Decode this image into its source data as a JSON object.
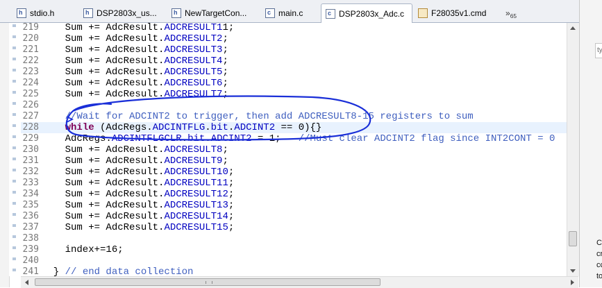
{
  "tabs": [
    {
      "label": "stdio.h",
      "icon": "h-file-icon",
      "active": false
    },
    {
      "label": "DSP2803x_us...",
      "icon": "h-file-icon",
      "active": false
    },
    {
      "label": "NewTargetCon...",
      "icon": "h-file-icon",
      "active": false
    },
    {
      "label": "main.c",
      "icon": "c-file-icon",
      "active": false
    },
    {
      "label": "DSP2803x_Adc.c",
      "icon": "c-file-icon",
      "active": true
    },
    {
      "label": "F28035v1.cmd",
      "icon": "cmd-file-icon",
      "active": false
    }
  ],
  "tab_overflow": {
    "chevron": "»",
    "count": "65"
  },
  "editor": {
    "current_line": "228",
    "lines": [
      {
        "num": "219",
        "parts": [
          {
            "t": "    Sum += AdcResult.",
            "c": ""
          },
          {
            "t": "ADCRESULT1",
            "c": "fld"
          },
          {
            "t": "1;",
            "c": ""
          }
        ]
      },
      {
        "num": "220",
        "parts": [
          {
            "t": "    Sum += AdcResult.",
            "c": ""
          },
          {
            "t": "ADCRESULT2",
            "c": "fld"
          },
          {
            "t": ";",
            "c": ""
          }
        ]
      },
      {
        "num": "221",
        "parts": [
          {
            "t": "    Sum += AdcResult.",
            "c": ""
          },
          {
            "t": "ADCRESULT3",
            "c": "fld"
          },
          {
            "t": ";",
            "c": ""
          }
        ]
      },
      {
        "num": "222",
        "parts": [
          {
            "t": "    Sum += AdcResult.",
            "c": ""
          },
          {
            "t": "ADCRESULT4",
            "c": "fld"
          },
          {
            "t": ";",
            "c": ""
          }
        ]
      },
      {
        "num": "223",
        "parts": [
          {
            "t": "    Sum += AdcResult.",
            "c": ""
          },
          {
            "t": "ADCRESULT5",
            "c": "fld"
          },
          {
            "t": ";",
            "c": ""
          }
        ]
      },
      {
        "num": "224",
        "parts": [
          {
            "t": "    Sum += AdcResult.",
            "c": ""
          },
          {
            "t": "ADCRESULT6",
            "c": "fld"
          },
          {
            "t": ";",
            "c": ""
          }
        ]
      },
      {
        "num": "225",
        "parts": [
          {
            "t": "    Sum += AdcResult.",
            "c": ""
          },
          {
            "t": "ADCRESULT7",
            "c": "fld"
          },
          {
            "t": ";",
            "c": ""
          }
        ]
      },
      {
        "num": "226",
        "parts": []
      },
      {
        "num": "227",
        "parts": [
          {
            "t": "    //Wait for ADCINT2 to trigger, then add ADCRESULT8-15 registers to sum",
            "c": "cm"
          }
        ]
      },
      {
        "num": "228",
        "parts": [
          {
            "t": "    ",
            "c": ""
          },
          {
            "t": "while",
            "c": "kw"
          },
          {
            "t": " (AdcRegs.",
            "c": ""
          },
          {
            "t": "ADCINTFLG",
            "c": "fld"
          },
          {
            "t": ".",
            "c": ""
          },
          {
            "t": "bit",
            "c": "fld"
          },
          {
            "t": ".",
            "c": ""
          },
          {
            "t": "ADCINT2",
            "c": "fld"
          },
          {
            "t": " == 0){}",
            "c": ""
          }
        ]
      },
      {
        "num": "229",
        "parts": [
          {
            "t": "    AdcRegs.",
            "c": ""
          },
          {
            "t": "ADCINTFLGCLR",
            "c": "fld"
          },
          {
            "t": ".",
            "c": ""
          },
          {
            "t": "bit",
            "c": "fld"
          },
          {
            "t": ".",
            "c": ""
          },
          {
            "t": "ADCINT2",
            "c": "fld"
          },
          {
            "t": " = 1;   ",
            "c": ""
          },
          {
            "t": "//Must clear ADCINT2 flag since INT2CONT = 0",
            "c": "cm"
          }
        ]
      },
      {
        "num": "230",
        "parts": [
          {
            "t": "    Sum += AdcResult.",
            "c": ""
          },
          {
            "t": "ADCRESULT8",
            "c": "fld"
          },
          {
            "t": ";",
            "c": ""
          }
        ]
      },
      {
        "num": "231",
        "parts": [
          {
            "t": "    Sum += AdcResult.",
            "c": ""
          },
          {
            "t": "ADCRESULT9",
            "c": "fld"
          },
          {
            "t": ";",
            "c": ""
          }
        ]
      },
      {
        "num": "232",
        "parts": [
          {
            "t": "    Sum += AdcResult.",
            "c": ""
          },
          {
            "t": "ADCRESULT10",
            "c": "fld"
          },
          {
            "t": ";",
            "c": ""
          }
        ]
      },
      {
        "num": "233",
        "parts": [
          {
            "t": "    Sum += AdcResult.",
            "c": ""
          },
          {
            "t": "ADCRESULT11",
            "c": "fld"
          },
          {
            "t": ";",
            "c": ""
          }
        ]
      },
      {
        "num": "234",
        "parts": [
          {
            "t": "    Sum += AdcResult.",
            "c": ""
          },
          {
            "t": "ADCRESULT12",
            "c": "fld"
          },
          {
            "t": ";",
            "c": ""
          }
        ]
      },
      {
        "num": "235",
        "parts": [
          {
            "t": "    Sum += AdcResult.",
            "c": ""
          },
          {
            "t": "ADCRESULT13",
            "c": "fld"
          },
          {
            "t": ";",
            "c": ""
          }
        ]
      },
      {
        "num": "236",
        "parts": [
          {
            "t": "    Sum += AdcResult.",
            "c": ""
          },
          {
            "t": "ADCRESULT14",
            "c": "fld"
          },
          {
            "t": ";",
            "c": ""
          }
        ]
      },
      {
        "num": "237",
        "parts": [
          {
            "t": "    Sum += AdcResult.",
            "c": ""
          },
          {
            "t": "ADCRESULT15",
            "c": "fld"
          },
          {
            "t": ";",
            "c": ""
          }
        ]
      },
      {
        "num": "238",
        "parts": []
      },
      {
        "num": "239",
        "parts": [
          {
            "t": "    index+=16;",
            "c": ""
          }
        ]
      },
      {
        "num": "240",
        "parts": []
      },
      {
        "num": "241",
        "parts": [
          {
            "t": "  } ",
            "c": ""
          },
          {
            "t": "// end data collection",
            "c": "cm"
          }
        ]
      }
    ]
  },
  "right_panel": {
    "search_fragment": "ty",
    "text_fragments": [
      "C",
      "cr",
      "cc",
      "to"
    ]
  },
  "colors": {
    "keyword": "#7f0055",
    "field": "#0000c0",
    "comment": "#3f5fbf",
    "current_line": "#e8f2fe",
    "annotation": "#1a2fd8"
  }
}
